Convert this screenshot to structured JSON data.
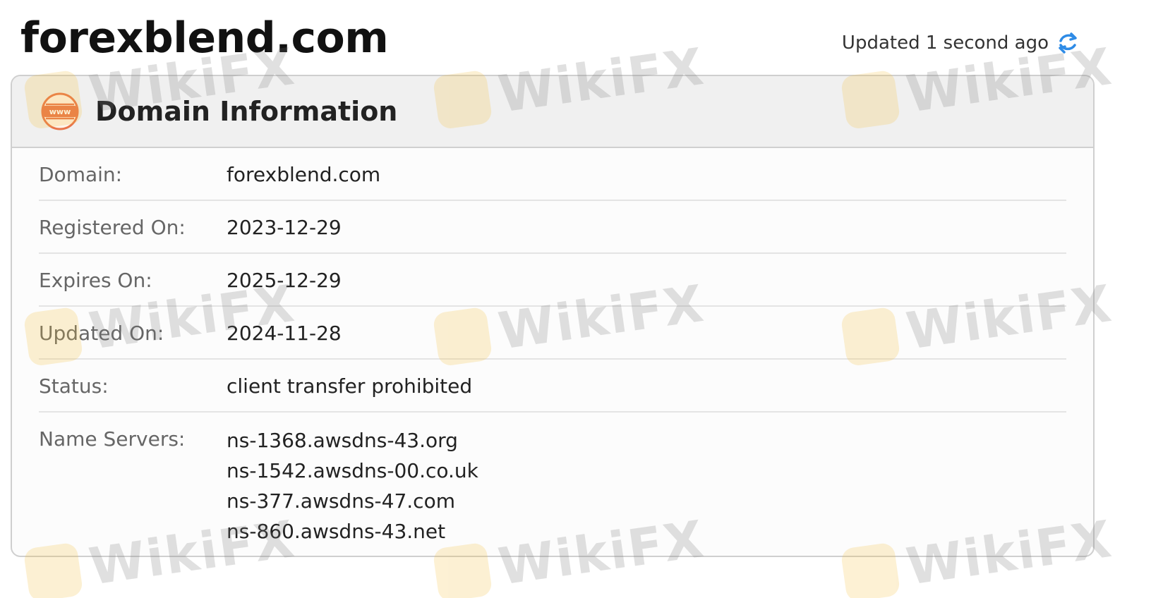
{
  "header": {
    "domain_title": "forexblend.com",
    "updated_text": "Updated 1 second ago",
    "refresh_icon": "refresh-icon"
  },
  "panel": {
    "title": "Domain Information",
    "icon": "www-globe-icon",
    "rows": [
      {
        "label": "Domain:",
        "value": "forexblend.com"
      },
      {
        "label": "Registered On:",
        "value": "2023-12-29"
      },
      {
        "label": "Expires On:",
        "value": "2025-12-29"
      },
      {
        "label": "Updated On:",
        "value": "2024-11-28"
      },
      {
        "label": "Status:",
        "value": "client transfer prohibited"
      }
    ],
    "name_servers": {
      "label": "Name Servers:",
      "values": [
        "ns-1368.awsdns-43.org",
        "ns-1542.awsdns-00.co.uk",
        "ns-377.awsdns-47.com",
        "ns-860.awsdns-43.net"
      ]
    }
  },
  "watermark": {
    "text": "WikiFX"
  },
  "colors": {
    "accent_blue": "#2e8be6",
    "icon_orange": "#e8744a",
    "watermark_gold": "#f5c03a"
  }
}
